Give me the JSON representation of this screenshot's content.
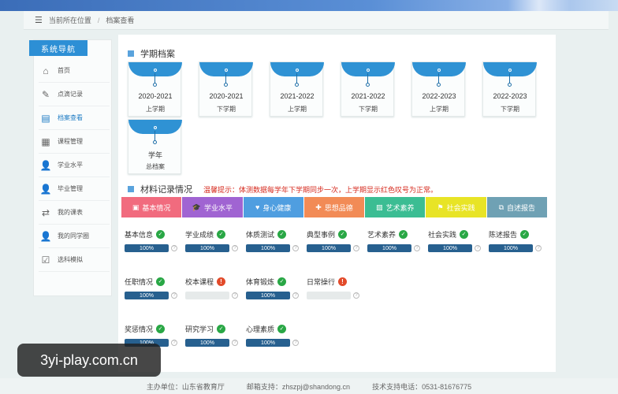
{
  "breadcrumb": {
    "menu_icon": "menu-icon",
    "location": "当前所在位置",
    "current": "档案查看"
  },
  "sidebar": {
    "title": "系统导航",
    "items": [
      {
        "label": "首页",
        "icon": "home-icon",
        "glyph": "⌂"
      },
      {
        "label": "点滴记录",
        "icon": "edit-icon",
        "glyph": "✎"
      },
      {
        "label": "档案查看",
        "icon": "archive-icon",
        "glyph": "▤"
      },
      {
        "label": "课程管理",
        "icon": "course-icon",
        "glyph": "▦"
      },
      {
        "label": "学业水平",
        "icon": "user-icon",
        "glyph": "👤"
      },
      {
        "label": "毕业管理",
        "icon": "graduate-icon",
        "glyph": "👤"
      },
      {
        "label": "我的课表",
        "icon": "schedule-icon",
        "glyph": "⇄"
      },
      {
        "label": "我的同学圈",
        "icon": "classmates-icon",
        "glyph": "👤"
      },
      {
        "label": "选科模拟",
        "icon": "clipboard-icon",
        "glyph": "☑"
      }
    ]
  },
  "terms": {
    "title": "学期档案",
    "items": [
      {
        "year": "2020-2021",
        "half": "上学期"
      },
      {
        "year": "2020-2021",
        "half": "下学期"
      },
      {
        "year": "2021-2022",
        "half": "上学期"
      },
      {
        "year": "2021-2022",
        "half": "下学期"
      },
      {
        "year": "2022-2023",
        "half": "上学期"
      },
      {
        "year": "2022-2023",
        "half": "下学期"
      },
      {
        "year": "学年",
        "half": "总档案"
      }
    ]
  },
  "records": {
    "title": "材料记录情况",
    "notice": "温馨提示：体测数据每学年下学期同步一次，上学期显示红色叹号为正常。",
    "tabs": [
      {
        "label": "基本情况",
        "color": "#f16b7e",
        "glyph": "▣"
      },
      {
        "label": "学业水平",
        "color": "#a064d2",
        "glyph": "🎓"
      },
      {
        "label": "身心健康",
        "color": "#4f9ee0",
        "glyph": "♥"
      },
      {
        "label": "思想品德",
        "color": "#f28b56",
        "glyph": "✚"
      },
      {
        "label": "艺术素养",
        "color": "#3bbd93",
        "glyph": "▨"
      },
      {
        "label": "社会实践",
        "color": "#e8e426",
        "glyph": "⚑"
      },
      {
        "label": "自述报告",
        "color": "#6fa1b4",
        "glyph": "⧉"
      }
    ],
    "items": [
      {
        "label": "基本信息",
        "status": "ok",
        "progress": "100%",
        "value": 1
      },
      {
        "label": "学业成绩",
        "status": "ok",
        "progress": "100%",
        "value": 1
      },
      {
        "label": "体质测试",
        "status": "ok",
        "progress": "100%",
        "value": 1
      },
      {
        "label": "典型事例",
        "status": "ok",
        "progress": "100%",
        "value": 1
      },
      {
        "label": "艺术素养",
        "status": "ok",
        "progress": "100%",
        "value": 1
      },
      {
        "label": "社会实践",
        "status": "ok",
        "progress": "100%",
        "value": 1
      },
      {
        "label": "陈述报告",
        "status": "ok",
        "progress": "100%",
        "value": 1
      },
      {
        "label": "任职情况",
        "status": "ok",
        "progress": "100%",
        "value": 1
      },
      {
        "label": "校本课程",
        "status": "warn",
        "progress": "",
        "value": 0
      },
      {
        "label": "体育锻炼",
        "status": "ok",
        "progress": "100%",
        "value": 1
      },
      {
        "label": "日常操行",
        "status": "warn",
        "progress": "",
        "value": 0
      },
      {
        "label": "奖惩情况",
        "status": "ok",
        "progress": "100%",
        "value": 1
      },
      {
        "label": "研究学习",
        "status": "ok",
        "progress": "100%",
        "value": 1
      },
      {
        "label": "心理素质",
        "status": "ok",
        "progress": "100%",
        "value": 1
      }
    ]
  },
  "footer": {
    "host": "主办单位：山东省教育厅",
    "email": "邮箱支持：zhszpj@shandong.cn",
    "phone": "技术支持电话：0531-81676775"
  },
  "watermark": "3yi-play.com.cn"
}
